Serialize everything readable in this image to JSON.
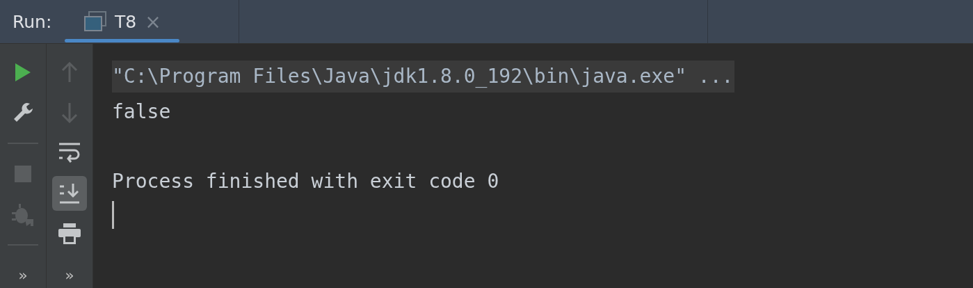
{
  "header": {
    "title": "Run:",
    "tabs": [
      {
        "label": "T8",
        "close": "×",
        "selected": true
      }
    ]
  },
  "toolbars": [
    {
      "items": [
        {
          "kind": "button",
          "disabled": false,
          "selected": false
        },
        {
          "kind": "button",
          "disabled": false,
          "selected": false
        },
        {
          "kind": "separator"
        },
        {
          "kind": "button",
          "disabled": true,
          "selected": false
        },
        {
          "kind": "button",
          "disabled": true,
          "selected": false
        },
        {
          "kind": "separator"
        }
      ],
      "more": "»"
    },
    {
      "items": [
        {
          "kind": "button",
          "disabled": true,
          "selected": false
        },
        {
          "kind": "button",
          "disabled": true,
          "selected": false
        },
        {
          "kind": "button",
          "disabled": false,
          "selected": false
        },
        {
          "kind": "button",
          "disabled": false,
          "selected": true
        },
        {
          "kind": "button",
          "disabled": false,
          "selected": false
        }
      ],
      "more": "»"
    }
  ],
  "console": {
    "lines": [
      {
        "kind": "command",
        "text": "\"C:\\Program Files\\Java\\jdk1.8.0_192\\bin\\java.exe\" ..."
      },
      {
        "kind": "output",
        "text": "false"
      },
      {
        "kind": "blank"
      },
      {
        "kind": "output",
        "text": "Process finished with exit code 0"
      }
    ],
    "cursor": true
  }
}
